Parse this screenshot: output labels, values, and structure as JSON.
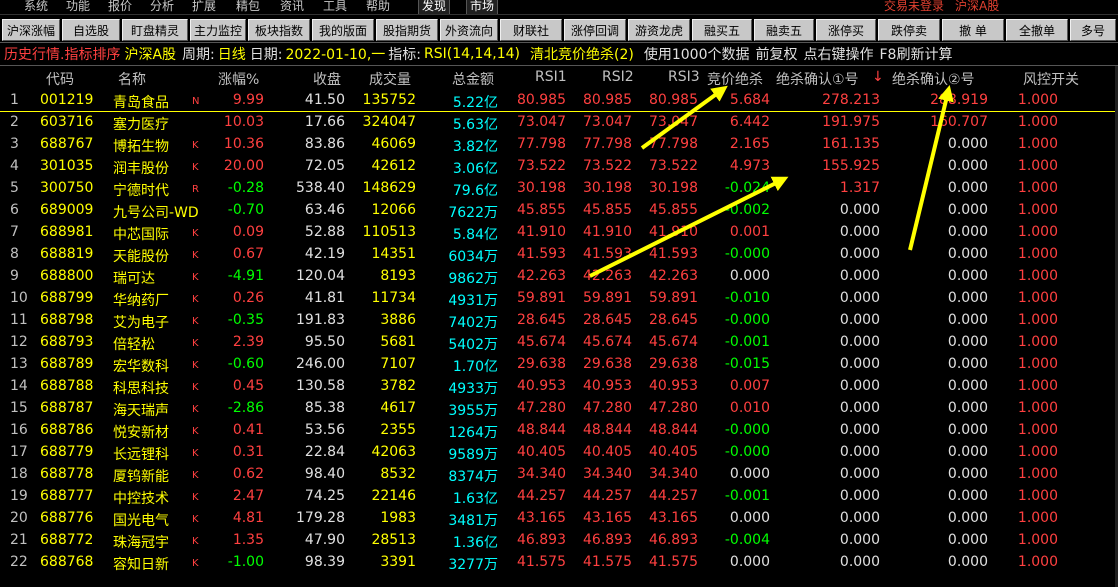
{
  "menu": {
    "items": [
      "系统",
      "功能",
      "报价",
      "分析",
      "扩展",
      "精包",
      "资讯",
      "工具",
      "帮助"
    ],
    "boxed": [
      "发现",
      "市场"
    ],
    "login": "交易未登录",
    "market_tag": "沪深A股"
  },
  "toolbar": {
    "buttons": [
      "沪深涨幅",
      "自选股",
      "盯盘精灵",
      "主力监控",
      "板块指数",
      "我的版面",
      "股指期货",
      "外资流向",
      "财联社",
      "涨停回调",
      "游资龙虎",
      "融买五",
      "融卖五",
      "涨停买",
      "跌停卖",
      "撤 单",
      "全撤单",
      "多号"
    ]
  },
  "infobar": {
    "title": "历史行情.指标排序",
    "market": "沪深A股",
    "period_label": "周期:",
    "period": "日线",
    "date_label": "日期:",
    "date": "2022-01-10,一",
    "indicator_label": "指标:",
    "indicator": "RSI(14,14,14)",
    "formula": "清北竞价绝杀(2)",
    "info1": "使用1000个数据",
    "info2": "前复权",
    "info3": "点右键操作",
    "info4": "F8刷新计算"
  },
  "columns": {
    "code": "代码",
    "name": "名称",
    "chg": "涨幅%",
    "close": "收盘",
    "vol": "成交量",
    "amt": "总金额",
    "rsi1": "RSI1",
    "rsi2": "RSI2",
    "rsi3": "RSI3",
    "jjs": "竞价绝杀",
    "qr1": "绝杀确认①号",
    "sort_arrow": "↓",
    "qr2": "绝杀确认②号",
    "fk": "风控开关"
  },
  "rows": [
    {
      "i": "1",
      "code": "001219",
      "name": "青岛食品",
      "flag": "N",
      "chg": "9.99",
      "close": "41.50",
      "vol": "135752",
      "amt": "5.22亿",
      "rsi1": "80.985",
      "rsi2": "80.985",
      "rsi3": "80.985",
      "jjs": "5.684",
      "qr1": "278.213",
      "qr2": "288.919",
      "fk": "1.000"
    },
    {
      "i": "2",
      "code": "603716",
      "name": "塞力医疗",
      "flag": "",
      "chg": "10.03",
      "close": "17.66",
      "vol": "324047",
      "amt": "5.63亿",
      "rsi1": "73.047",
      "rsi2": "73.047",
      "rsi3": "73.047",
      "jjs": "6.442",
      "qr1": "191.975",
      "qr2": "160.707",
      "fk": "1.000"
    },
    {
      "i": "3",
      "code": "688767",
      "name": "博拓生物",
      "flag": "K",
      "chg": "10.36",
      "close": "83.86",
      "vol": "46069",
      "amt": "3.82亿",
      "rsi1": "77.798",
      "rsi2": "77.798",
      "rsi3": "77.798",
      "jjs": "2.165",
      "qr1": "161.135",
      "qr2": "0.000",
      "fk": "1.000"
    },
    {
      "i": "4",
      "code": "301035",
      "name": "润丰股份",
      "flag": "K",
      "chg": "20.00",
      "close": "72.05",
      "vol": "42612",
      "amt": "3.06亿",
      "rsi1": "73.522",
      "rsi2": "73.522",
      "rsi3": "73.522",
      "jjs": "4.973",
      "qr1": "155.925",
      "qr2": "0.000",
      "fk": "1.000"
    },
    {
      "i": "5",
      "code": "300750",
      "name": "宁德时代",
      "flag": "R",
      "chg": "-0.28",
      "close": "538.40",
      "vol": "148629",
      "amt": "79.6亿",
      "rsi1": "30.198",
      "rsi2": "30.198",
      "rsi3": "30.198",
      "jjs": "-0.024",
      "qr1": "1.317",
      "qr2": "0.000",
      "fk": "1.000"
    },
    {
      "i": "6",
      "code": "689009",
      "name": "九号公司-WD",
      "flag": "",
      "chg": "-0.70",
      "close": "63.46",
      "vol": "12066",
      "amt": "7622万",
      "rsi1": "45.855",
      "rsi2": "45.855",
      "rsi3": "45.855",
      "jjs": "-0.002",
      "qr1": "0.000",
      "qr2": "0.000",
      "fk": "1.000"
    },
    {
      "i": "7",
      "code": "688981",
      "name": "中芯国际",
      "flag": "K",
      "chg": "0.09",
      "close": "52.88",
      "vol": "110513",
      "amt": "5.84亿",
      "rsi1": "41.910",
      "rsi2": "41.910",
      "rsi3": "41.910",
      "jjs": "0.001",
      "qr1": "0.000",
      "qr2": "0.000",
      "fk": "1.000"
    },
    {
      "i": "8",
      "code": "688819",
      "name": "天能股份",
      "flag": "K",
      "chg": "0.67",
      "close": "42.19",
      "vol": "14351",
      "amt": "6034万",
      "rsi1": "41.593",
      "rsi2": "41.593",
      "rsi3": "41.593",
      "jjs": "-0.000",
      "qr1": "0.000",
      "qr2": "0.000",
      "fk": "1.000"
    },
    {
      "i": "9",
      "code": "688800",
      "name": "瑞可达",
      "flag": "K",
      "chg": "-4.91",
      "close": "120.04",
      "vol": "8193",
      "amt": "9862万",
      "rsi1": "42.263",
      "rsi2": "42.263",
      "rsi3": "42.263",
      "jjs": "0.000",
      "qr1": "0.000",
      "qr2": "0.000",
      "fk": "1.000"
    },
    {
      "i": "10",
      "code": "688799",
      "name": "华纳药厂",
      "flag": "K",
      "chg": "0.26",
      "close": "41.81",
      "vol": "11734",
      "amt": "4931万",
      "rsi1": "59.891",
      "rsi2": "59.891",
      "rsi3": "59.891",
      "jjs": "-0.010",
      "qr1": "0.000",
      "qr2": "0.000",
      "fk": "1.000"
    },
    {
      "i": "11",
      "code": "688798",
      "name": "艾为电子",
      "flag": "K",
      "chg": "-0.35",
      "close": "191.83",
      "vol": "3886",
      "amt": "7402万",
      "rsi1": "28.645",
      "rsi2": "28.645",
      "rsi3": "28.645",
      "jjs": "-0.000",
      "qr1": "0.000",
      "qr2": "0.000",
      "fk": "1.000"
    },
    {
      "i": "12",
      "code": "688793",
      "name": "倍轻松",
      "flag": "K",
      "chg": "2.39",
      "close": "95.50",
      "vol": "5681",
      "amt": "5402万",
      "rsi1": "45.674",
      "rsi2": "45.674",
      "rsi3": "45.674",
      "jjs": "-0.001",
      "qr1": "0.000",
      "qr2": "0.000",
      "fk": "1.000"
    },
    {
      "i": "13",
      "code": "688789",
      "name": "宏华数科",
      "flag": "K",
      "chg": "-0.60",
      "close": "246.00",
      "vol": "7107",
      "amt": "1.70亿",
      "rsi1": "29.638",
      "rsi2": "29.638",
      "rsi3": "29.638",
      "jjs": "-0.015",
      "qr1": "0.000",
      "qr2": "0.000",
      "fk": "1.000"
    },
    {
      "i": "14",
      "code": "688788",
      "name": "科思科技",
      "flag": "K",
      "chg": "0.45",
      "close": "130.58",
      "vol": "3782",
      "amt": "4933万",
      "rsi1": "40.953",
      "rsi2": "40.953",
      "rsi3": "40.953",
      "jjs": "0.007",
      "qr1": "0.000",
      "qr2": "0.000",
      "fk": "1.000"
    },
    {
      "i": "15",
      "code": "688787",
      "name": "海天瑞声",
      "flag": "K",
      "chg": "-2.86",
      "close": "85.38",
      "vol": "4617",
      "amt": "3955万",
      "rsi1": "47.280",
      "rsi2": "47.280",
      "rsi3": "47.280",
      "jjs": "0.010",
      "qr1": "0.000",
      "qr2": "0.000",
      "fk": "1.000"
    },
    {
      "i": "16",
      "code": "688786",
      "name": "悦安新材",
      "flag": "K",
      "chg": "0.41",
      "close": "53.56",
      "vol": "2355",
      "amt": "1264万",
      "rsi1": "48.844",
      "rsi2": "48.844",
      "rsi3": "48.844",
      "jjs": "-0.000",
      "qr1": "0.000",
      "qr2": "0.000",
      "fk": "1.000"
    },
    {
      "i": "17",
      "code": "688779",
      "name": "长远锂科",
      "flag": "K",
      "chg": "0.31",
      "close": "22.84",
      "vol": "42063",
      "amt": "9589万",
      "rsi1": "40.405",
      "rsi2": "40.405",
      "rsi3": "40.405",
      "jjs": "-0.000",
      "qr1": "0.000",
      "qr2": "0.000",
      "fk": "1.000"
    },
    {
      "i": "18",
      "code": "688778",
      "name": "厦钨新能",
      "flag": "K",
      "chg": "0.62",
      "close": "98.40",
      "vol": "8532",
      "amt": "8374万",
      "rsi1": "34.340",
      "rsi2": "34.340",
      "rsi3": "34.340",
      "jjs": "0.000",
      "qr1": "0.000",
      "qr2": "0.000",
      "fk": "1.000"
    },
    {
      "i": "19",
      "code": "688777",
      "name": "中控技术",
      "flag": "K",
      "chg": "2.47",
      "close": "74.25",
      "vol": "22146",
      "amt": "1.63亿",
      "rsi1": "44.257",
      "rsi2": "44.257",
      "rsi3": "44.257",
      "jjs": "-0.001",
      "qr1": "0.000",
      "qr2": "0.000",
      "fk": "1.000"
    },
    {
      "i": "20",
      "code": "688776",
      "name": "国光电气",
      "flag": "K",
      "chg": "4.81",
      "close": "179.28",
      "vol": "1983",
      "amt": "3481万",
      "rsi1": "43.165",
      "rsi2": "43.165",
      "rsi3": "43.165",
      "jjs": "0.000",
      "qr1": "0.000",
      "qr2": "0.000",
      "fk": "1.000"
    },
    {
      "i": "21",
      "code": "688772",
      "name": "珠海冠宇",
      "flag": "K",
      "chg": "1.35",
      "close": "47.90",
      "vol": "28513",
      "amt": "1.36亿",
      "rsi1": "46.893",
      "rsi2": "46.893",
      "rsi3": "46.893",
      "jjs": "-0.004",
      "qr1": "0.000",
      "qr2": "0.000",
      "fk": "1.000"
    },
    {
      "i": "22",
      "code": "688768",
      "name": "容知日新",
      "flag": "K",
      "chg": "-1.00",
      "close": "98.39",
      "vol": "3391",
      "amt": "3277万",
      "rsi1": "41.575",
      "rsi2": "41.575",
      "rsi3": "41.575",
      "jjs": "0.000",
      "qr1": "0.000",
      "qr2": "0.000",
      "fk": "1.000"
    }
  ],
  "colors": {
    "up": "#ff4040",
    "down": "#00ff00",
    "flat": "#e0e0e0",
    "arrow": "#ffff00"
  }
}
